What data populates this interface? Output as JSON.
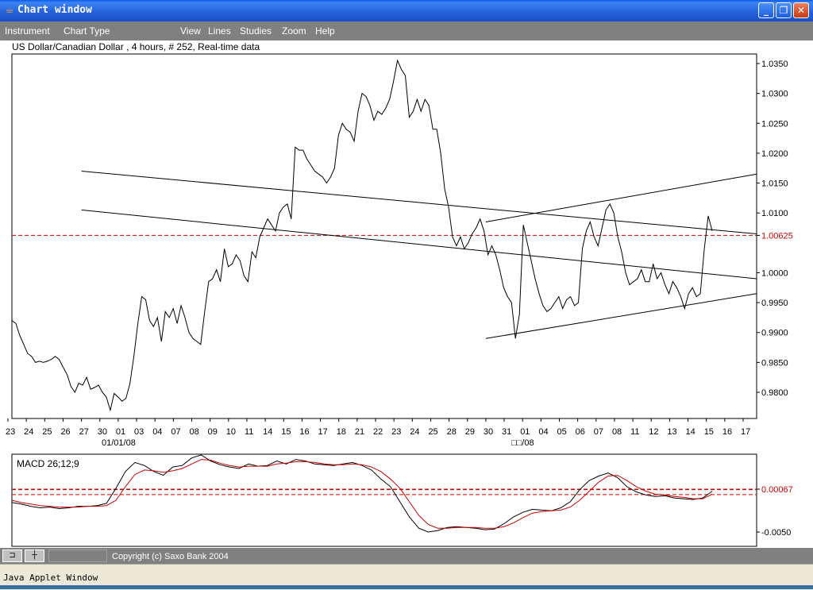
{
  "window": {
    "title": "Chart window",
    "icon": "java-cup-icon",
    "buttons": [
      "minimize-icon",
      "restore-icon",
      "close-icon"
    ]
  },
  "menu": {
    "items": [
      {
        "label": "Instrument"
      },
      {
        "label": "Chart Type"
      },
      {
        "label": "View"
      },
      {
        "label": "Lines"
      },
      {
        "label": "Studies"
      },
      {
        "label": "Zoom"
      },
      {
        "label": "Help"
      }
    ]
  },
  "chart_header": {
    "text": "US Dollar/Canadian Dollar , 4 hours, # 252, Real-time data"
  },
  "status": {
    "copyright": "Copyright (c) Saxo Bank 2004",
    "btn1": "⊐",
    "btn2": "┼"
  },
  "applet": {
    "label": "Java Applet Window"
  },
  "colors": {
    "price_line": "#000000",
    "ref_line": "#cc0000",
    "signal_line": "#cc0000",
    "title_bar": "#2462dc"
  },
  "chart_data": [
    {
      "type": "line",
      "title": "US Dollar/Canadian Dollar , 4 hours, # 252, Real-time data",
      "y_ticks": [
        "1.0350",
        "1.0300",
        "1.0250",
        "1.0200",
        "1.0150",
        "1.0100",
        "1.00625",
        "1.0000",
        "0.9950",
        "0.9900",
        "0.9850",
        "0.9800"
      ],
      "ylim": [
        0.9755,
        1.0365
      ],
      "reference_line": {
        "value": 1.00625,
        "label": "1.00625",
        "style": "dashed",
        "color": "#cc0000"
      },
      "x_ticks": [
        "23",
        "24",
        "25",
        "26",
        "27",
        "30",
        "01",
        "03",
        "04",
        "07",
        "08",
        "09",
        "10",
        "11",
        "14",
        "15",
        "16",
        "17",
        "18",
        "21",
        "22",
        "23",
        "24",
        "25",
        "28",
        "29",
        "30",
        "31",
        "01",
        "04",
        "05",
        "06",
        "07",
        "08",
        "11",
        "12",
        "13",
        "14",
        "15",
        "16",
        "17"
      ],
      "x_sublabels": [
        "01/01/08",
        "□□/08"
      ],
      "series": [
        {
          "values": [
            0.992,
            0.9915,
            0.9895,
            0.988,
            0.9865,
            0.986,
            0.985,
            0.9852,
            0.985,
            0.9852,
            0.9855,
            0.986,
            0.9855,
            0.9842,
            0.983,
            0.981,
            0.98,
            0.9815,
            0.9812,
            0.9825,
            0.9805,
            0.9808,
            0.9812,
            0.98,
            0.9792,
            0.977,
            0.9798,
            0.9792,
            0.9785,
            0.979,
            0.9815,
            0.986,
            0.9915,
            0.996,
            0.9955,
            0.992,
            0.991,
            0.9925,
            0.9885,
            0.9935,
            0.9925,
            0.994,
            0.9915,
            0.9945,
            0.9925,
            0.99,
            0.989,
            0.9885,
            0.988,
            0.9935,
            0.9985,
            0.999,
            1.0005,
            0.9985,
            1.004,
            1.001,
            1.0015,
            1.003,
            1.002,
            0.9995,
            0.9985,
            1.0035,
            1.0025,
            1.006,
            1.0075,
            1.009,
            1.008,
            1.007,
            1.01,
            1.011,
            1.0115,
            1.009,
            1.021,
            1.0205,
            1.0205,
            1.019,
            1.018,
            1.017,
            1.0165,
            1.016,
            1.015,
            1.016,
            1.0175,
            1.023,
            1.025,
            1.024,
            1.0235,
            1.022,
            1.027,
            1.03,
            1.0295,
            1.028,
            1.0255,
            1.027,
            1.0265,
            1.0275,
            1.029,
            1.032,
            1.0355,
            1.034,
            1.033,
            1.026,
            1.027,
            1.029,
            1.027,
            1.029,
            1.028,
            1.024,
            1.024,
            1.02,
            1.014,
            1.011,
            1.006,
            1.0045,
            1.006,
            1.004,
            1.005,
            1.0065,
            1.0075,
            1.009,
            1.007,
            1.003,
            1.0045,
            1.003,
            1.0005,
            0.9975,
            0.996,
            0.995,
            0.989,
            0.993,
            1.008,
            1.005,
            1.002,
            0.999,
            0.9965,
            0.9945,
            0.9935,
            0.994,
            0.995,
            0.996,
            0.994,
            0.9955,
            0.996,
            0.9945,
            0.995,
            1.004,
            1.007,
            1.0085,
            1.006,
            1.0045,
            1.0075,
            1.0105,
            1.0115,
            1.01,
            1.006,
            1.0035,
            1.0,
            0.998,
            0.9985,
            0.999,
            1.0005,
            0.9985,
            0.9985,
            1.0015,
            0.999,
            1.0,
            0.998,
            0.9965,
            0.9985,
            0.9975,
            0.996,
            0.994,
            0.9965,
            0.9975,
            0.996,
            0.9965,
            1.004,
            1.0095,
            1.007
          ]
        }
      ],
      "trendlines": [
        {
          "from": {
            "x": "27",
            "y": 1.017
          },
          "to": {
            "x": "17",
            "y": 1.0065
          }
        },
        {
          "from": {
            "x": "27",
            "y": 1.0105
          },
          "to": {
            "x": "17",
            "y": 0.999
          }
        },
        {
          "from": {
            "x": "30",
            "y": 1.0085
          },
          "to": {
            "x": "17",
            "y": 1.0165
          }
        },
        {
          "from": {
            "x": "30",
            "y": 0.989
          },
          "to": {
            "x": "17",
            "y": 0.9965
          }
        }
      ]
    },
    {
      "type": "line",
      "title": "MACD 26;12;9",
      "y_ticks": [
        "0.00067",
        "-0.0050"
      ],
      "reference_lines": [
        0.00067,
        0.0006,
        -5e-05
      ],
      "series": [
        {
          "name": "MACD",
          "color": "#000000",
          "values": [
            -0.0011,
            -0.0013,
            -0.0016,
            -0.0018,
            -0.0017,
            -0.0019,
            -0.0018,
            -0.0016,
            -0.0016,
            -0.0015,
            -0.0012,
            0.0008,
            0.003,
            0.0042,
            0.0038,
            0.003,
            0.0025,
            0.0036,
            0.0038,
            0.0048,
            0.0052,
            0.0044,
            0.0039,
            0.0036,
            0.0034,
            0.004,
            0.0037,
            0.0038,
            0.0044,
            0.004,
            0.0046,
            0.0044,
            0.004,
            0.0039,
            0.0038,
            0.004,
            0.0042,
            0.0038,
            0.0032,
            0.002,
            0.001,
            -0.001,
            -0.003,
            -0.0045,
            -0.005,
            -0.0048,
            -0.0044,
            -0.0043,
            -0.0044,
            -0.0045,
            -0.0047,
            -0.0046,
            -0.0039,
            -0.003,
            -0.0024,
            -0.002,
            -0.0021,
            -0.0022,
            -0.0018,
            -0.001,
            0.0006,
            0.0018,
            0.0024,
            0.0028,
            0.0022,
            0.001,
            0.0003,
            -0.0001,
            -0.0003,
            -0.0002,
            -0.0005,
            -0.0006,
            -0.0007,
            -0.0005,
            0.0004
          ]
        },
        {
          "name": "Signal",
          "color": "#cc0000",
          "values": [
            -0.0008,
            -0.0011,
            -0.0013,
            -0.0015,
            -0.0016,
            -0.0017,
            -0.0017,
            -0.0017,
            -0.0016,
            -0.0016,
            -0.0015,
            -0.0008,
            0.001,
            0.0026,
            0.0032,
            0.0031,
            0.0029,
            0.0031,
            0.0034,
            0.004,
            0.0046,
            0.0045,
            0.0041,
            0.0038,
            0.0036,
            0.0037,
            0.0037,
            0.0037,
            0.004,
            0.0041,
            0.0043,
            0.0043,
            0.0042,
            0.004,
            0.0039,
            0.0039,
            0.004,
            0.0039,
            0.0036,
            0.003,
            0.002,
            0.0008,
            -0.001,
            -0.0028,
            -0.004,
            -0.0045,
            -0.0045,
            -0.0044,
            -0.0044,
            -0.0044,
            -0.0045,
            -0.0045,
            -0.0043,
            -0.0038,
            -0.0031,
            -0.0025,
            -0.0023,
            -0.0022,
            -0.0021,
            -0.0017,
            -0.0008,
            0.0004,
            0.0016,
            0.0024,
            0.0025,
            0.0018,
            0.001,
            0.0004,
            0.0,
            -0.0001,
            -0.0003,
            -0.0004,
            -0.0006,
            -0.0006,
            0.0
          ]
        }
      ]
    }
  ]
}
